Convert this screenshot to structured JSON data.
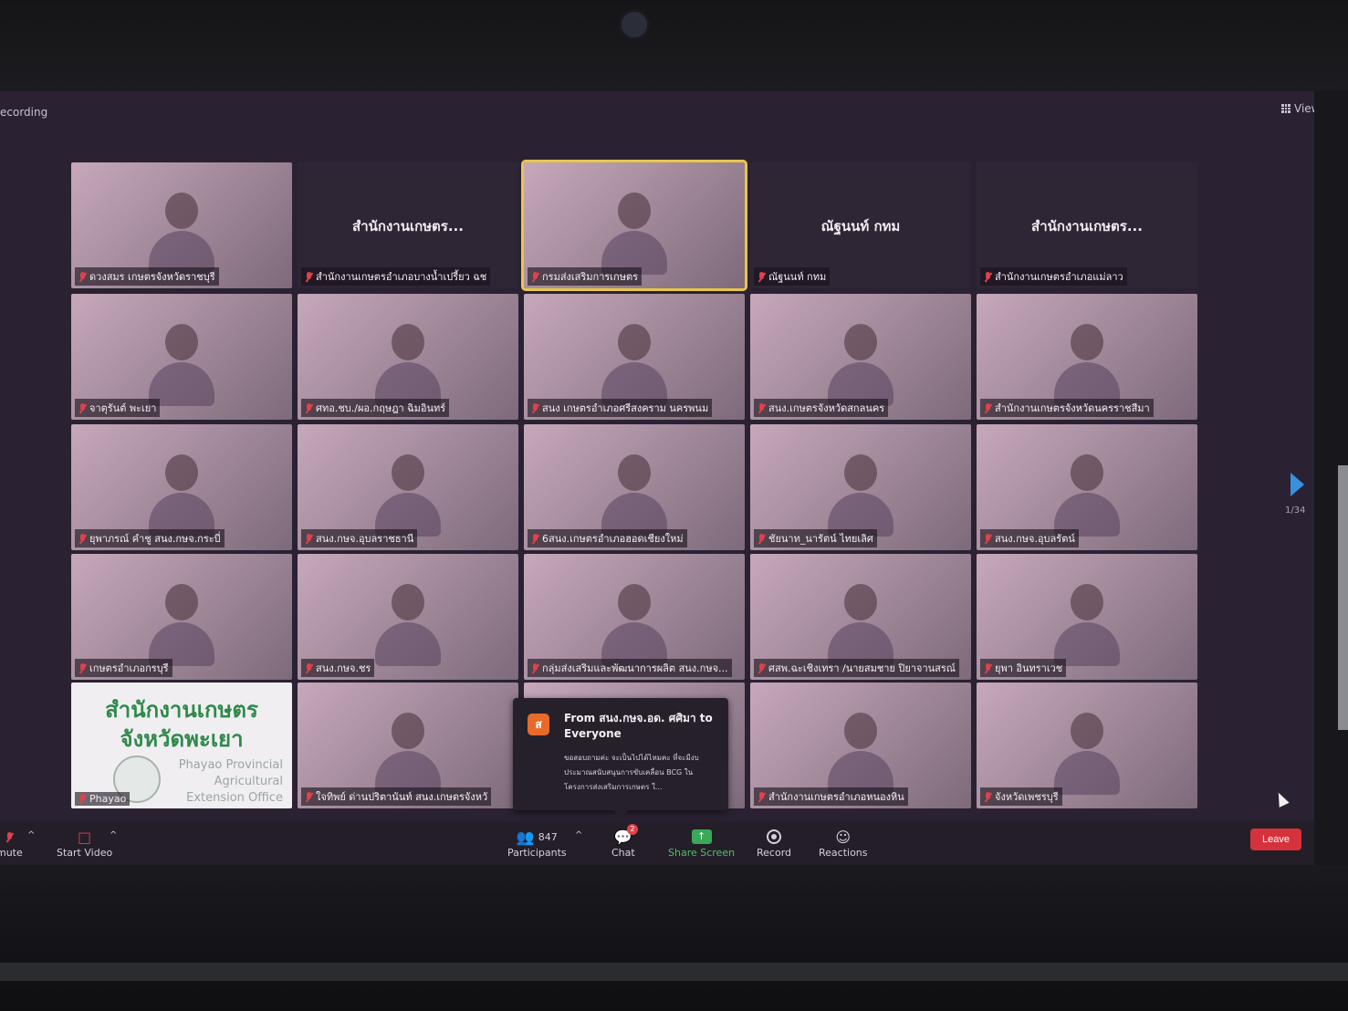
{
  "app": {
    "recording_label": "ecording",
    "view_label": "View",
    "page_indicator": "1/34"
  },
  "tiles": [
    {
      "name": "ดวงสมร เกษตรจังหวัดราชบุรี",
      "type": "video"
    },
    {
      "name": "สำนักงานเกษตรอำเภอบางน้ำเปรี้ยว ฉช",
      "center": "สำนักงานเกษตร...",
      "type": "dark"
    },
    {
      "name": "กรมส่งเสริมการเกษตร",
      "type": "video",
      "active": true
    },
    {
      "name": "ณัฐนนท์ กทม",
      "center": "ณัฐนนท์ กทม",
      "type": "dark"
    },
    {
      "name": "สำนักงานเกษตรอำเภอแม่ลาว",
      "center": "สำนักงานเกษตร...",
      "type": "dark"
    },
    {
      "name": "จาตุรันต์ พะเยา",
      "type": "video"
    },
    {
      "name": "ศทอ.ชบ./ผอ.กฤษฎา ฉิมอินทร์",
      "type": "video"
    },
    {
      "name": "สนง เกษตรอำเภอศรีสงคราม นครพนม",
      "type": "video"
    },
    {
      "name": "สนง.เกษตรจังหวัดสกลนคร",
      "type": "video"
    },
    {
      "name": "สำนักงานเกษตรจังหวัดนครราชสีมา",
      "type": "video"
    },
    {
      "name": "ยุพาภรณ์ คำชู สนง.กษจ.กระบี่",
      "type": "video"
    },
    {
      "name": "สนง.กษจ.อุบลราชธานี",
      "type": "video"
    },
    {
      "name": "6สนง.เกษตรอำเภอฮอดเชียงใหม่",
      "type": "video"
    },
    {
      "name": "ชัยนาท_นารัตน์ ไทยเลิศ",
      "type": "video"
    },
    {
      "name": "สนง.กษจ.อุบลรัตน์",
      "type": "video"
    },
    {
      "name": "เกษตรอำเภอกรบุรี",
      "type": "video"
    },
    {
      "name": "สนง.กษจ.ชร",
      "type": "video"
    },
    {
      "name": "กลุ่มส่งเสริมและพัฒนาการผลิต สนง.กษจ...",
      "type": "video"
    },
    {
      "name": "ศสพ.ฉะเชิงเทรา /นายสมชาย ปิยาจานสรณ์",
      "type": "video"
    },
    {
      "name": "ยุพา อินทราเวช",
      "type": "video"
    },
    {
      "name": "Phayao",
      "type": "phayao",
      "th_title_1": "สำนักงานเกษตร",
      "th_title_2": "จังหวัดพะเยา",
      "en_title_1": "Phayao Provincial",
      "en_title_2": "Agricultural",
      "en_title_3": "Extension Office"
    },
    {
      "name": "ใจทิพย์ ด่านปริตานันท์ สนง.เกษตรจังหวั",
      "type": "video"
    },
    {
      "name": "",
      "type": "video"
    },
    {
      "name": "สำนักงานเกษตรอำเภอหนองหิน",
      "type": "video"
    },
    {
      "name": "จังหวัดเพชรบุรี",
      "type": "video"
    }
  ],
  "chat_popup": {
    "avatar_letter": "ส",
    "from": "From สนง.กษจ.อด. ศศิมา to Everyone",
    "message": "ขอสอบถามค่ะ จะเป็นไปได้ไหมคะ ที่จะมีงบประมาณสนับสนุนการขับเคลื่อน BCG ในโครงการส่งเสริมการเกษตร ใ..."
  },
  "toolbar": {
    "mute_label": "mute",
    "start_video_label": "Start Video",
    "participants_count": "847",
    "participants_label": "Participants",
    "chat_label": "Chat",
    "chat_badge": "2",
    "share_screen_label": "Share Screen",
    "record_label": "Record",
    "reactions_label": "Reactions",
    "leave_label": "Leave"
  },
  "colors": {
    "active_speaker": "#e8c64a",
    "share_green": "#3aa858",
    "leave_red": "#d6323c",
    "mic_muted": "#e0414a"
  }
}
